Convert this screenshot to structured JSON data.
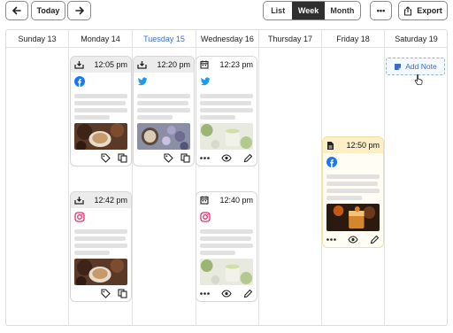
{
  "toolbar": {
    "today_label": "Today",
    "views": [
      "List",
      "Week",
      "Month"
    ],
    "active_view": "Week",
    "more_label": "•••",
    "export_label": "Export"
  },
  "days": [
    {
      "label": "Sunday 13",
      "today": false
    },
    {
      "label": "Monday 14",
      "today": false
    },
    {
      "label": "Tuesday 15",
      "today": true
    },
    {
      "label": "Wednesday 16",
      "today": false
    },
    {
      "label": "Thursday 17",
      "today": false
    },
    {
      "label": "Friday 18",
      "today": false
    },
    {
      "label": "Saturday 19",
      "today": false
    }
  ],
  "posts": [
    {
      "time": "12:05 pm",
      "network": "facebook",
      "status": "published"
    },
    {
      "time": "12:20 pm",
      "network": "twitter",
      "status": "published"
    },
    {
      "time": "12:23 pm",
      "network": "twitter",
      "status": "scheduled"
    },
    {
      "time": "12:42 pm",
      "network": "instagram",
      "status": "published"
    },
    {
      "time": "12:40 pm",
      "network": "instagram",
      "status": "scheduled"
    },
    {
      "time": "12:50 pm",
      "network": "facebook",
      "status": "draft"
    }
  ],
  "add_note_label": "Add Note",
  "colors": {
    "accent": "#3a6fc4",
    "facebook": "#1877f2",
    "twitter": "#1d9bf0",
    "instagram": "#e1306c",
    "draft_header": "#fcefc6"
  }
}
